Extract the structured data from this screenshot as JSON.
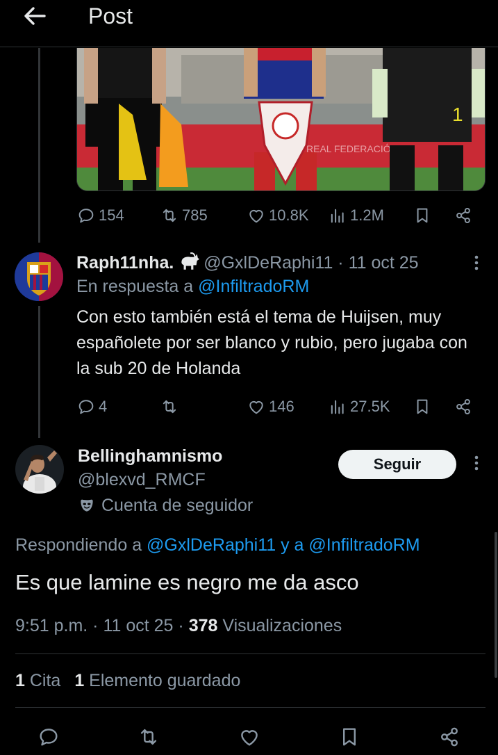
{
  "header": {
    "title": "Post"
  },
  "original_tweet_actions": {
    "replies": "154",
    "reposts": "785",
    "likes": "10.8K",
    "views": "1.2M"
  },
  "reply": {
    "display_name": "Raph11nha.",
    "handle": "@GxlDeRaphi11",
    "date_sep": " · ",
    "date": "11 oct 25",
    "replying_prefix": "En respuesta a ",
    "replying_to": "@InfiltradoRM",
    "text": "Con esto también está el tema de Huijsen, muy españolete por ser blanco y rubio, pero jugaba con la sub 20 de Holanda",
    "actions": {
      "replies": "4",
      "reposts": "",
      "likes": "146",
      "views": "27.5K"
    }
  },
  "main_post": {
    "display_name": "Bellinghamnismo",
    "handle": "@blexvd_RMCF",
    "follow_label": "Seguir",
    "fan_account_label": "Cuenta de seguidor",
    "responding_prefix": "Respondiendo a ",
    "responding_user1": "@GxlDeRaphi11",
    "responding_joiner": " y a ",
    "responding_user2": "@InfiltradoRM",
    "text": "Es que lamine es negro me da asco",
    "time": "9:51 p.m.",
    "dot": " · ",
    "date": "11 oct 25",
    "views_count": "378",
    "views_label": " Visualizaciones",
    "quotes_count": "1",
    "quotes_label": " Cita",
    "bookmarks_count": "1",
    "bookmarks_label": " Elemento guardado"
  },
  "colors": {
    "background": "#000000",
    "text": "#e7e9ea",
    "muted": "#8b98a5",
    "link": "#1d9bf0",
    "divider": "#2f3336"
  },
  "icons": [
    "back-arrow-icon",
    "reply-icon",
    "repost-icon",
    "like-icon",
    "views-icon",
    "bookmark-icon",
    "share-icon",
    "more-icon",
    "fan-mask-icon"
  ]
}
